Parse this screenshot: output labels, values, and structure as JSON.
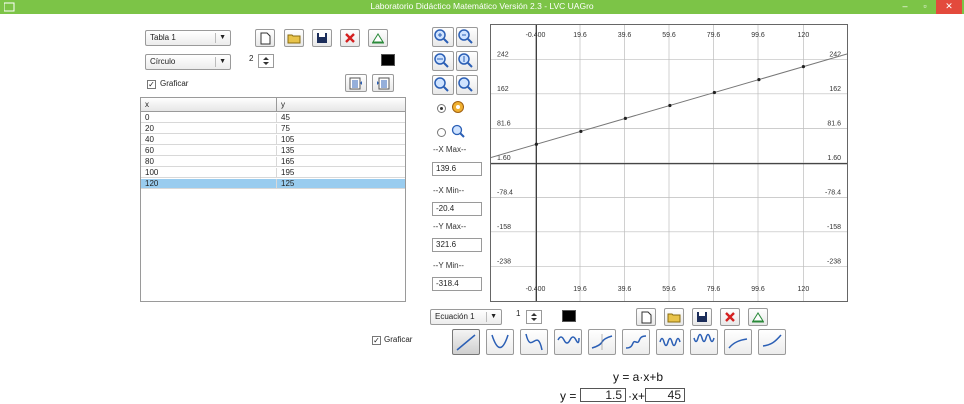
{
  "window": {
    "title": "Laboratorio Didáctico Matemático Versión 2.3 - LVC UAGro",
    "min_glyph": "–",
    "max_glyph": "▫",
    "close_glyph": "✕"
  },
  "left_panel": {
    "table_select": "Tabla 1",
    "shape_select": "Círculo",
    "point_size": "2",
    "graficar_label": "Graficar",
    "graficar_checked": "✓",
    "point_color": "#000000",
    "columns": [
      "x",
      "y"
    ],
    "rows": [
      [
        "0",
        "45"
      ],
      [
        "20",
        "75"
      ],
      [
        "40",
        "105"
      ],
      [
        "60",
        "135"
      ],
      [
        "80",
        "165"
      ],
      [
        "100",
        "195"
      ],
      [
        "120",
        "125"
      ]
    ],
    "selected_row_index": 6
  },
  "side_controls": {
    "xmax_label": "--X Max--",
    "xmax_value": "139.6",
    "xmin_label": "--X Min--",
    "xmin_value": "-20.4",
    "ymax_label": "--Y Max--",
    "ymax_value": "321.6",
    "ymin_label": "--Y Min--",
    "ymin_value": "-318.4"
  },
  "graph": {
    "x_ticks": [
      "-0.400",
      "19.6",
      "39.6",
      "59.6",
      "79.6",
      "99.6",
      "120"
    ],
    "y_ticks": [
      "242",
      "162",
      "81.6",
      "1.60",
      "-78.4",
      "-158",
      "-238"
    ]
  },
  "chart_data": {
    "type": "line",
    "xlim": [
      -20.4,
      139.6
    ],
    "ylim": [
      -318.4,
      321.6
    ],
    "x_ticks": [
      -0.4,
      19.6,
      39.6,
      59.6,
      79.6,
      99.6,
      120
    ],
    "y_ticks": [
      242,
      162,
      81.6,
      1.6,
      -78.4,
      -158,
      -238
    ],
    "line": {
      "slope": 1.5,
      "intercept": 45
    },
    "points": [
      {
        "x": 0,
        "y": 45
      },
      {
        "x": 20,
        "y": 75
      },
      {
        "x": 40,
        "y": 105
      },
      {
        "x": 60,
        "y": 135
      },
      {
        "x": 80,
        "y": 165
      },
      {
        "x": 100,
        "y": 195
      },
      {
        "x": 120,
        "y": 225
      }
    ],
    "grid": true
  },
  "equation_panel": {
    "equation_select": "Ecuación 1",
    "line_width": "1",
    "line_color": "#000000",
    "graficar_label": "Graficar",
    "graficar_checked": "✓",
    "formula": "y = a·x+b",
    "y_prefix": "y =",
    "a_value": "1.5",
    "x_mid": "·x+",
    "b_value": "45"
  },
  "colors": {
    "title_bar": "#7cc447",
    "selection": "#99ccef",
    "curve_blue": "#2b5fb5"
  }
}
